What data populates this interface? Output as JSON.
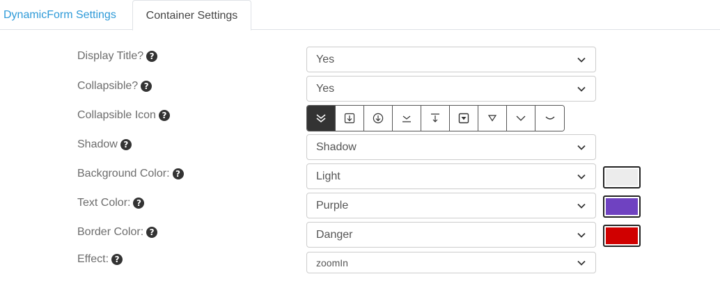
{
  "tabs": [
    {
      "label": "DynamicForm Settings"
    },
    {
      "label": "Container Settings"
    }
  ],
  "help_glyph": "?",
  "fields": {
    "display_title": {
      "label": "Display Title?",
      "value": "Yes"
    },
    "collapsible": {
      "label": "Collapsible?",
      "value": "Yes"
    },
    "collapsible_icon": {
      "label": "Collapsible Icon",
      "icons": [
        "double-chevron-down-icon",
        "box-arrow-down-icon",
        "circle-arrow-down-icon",
        "arrow-to-line-icon",
        "arrow-from-line-icon",
        "caret-square-down-icon",
        "triangle-down-icon",
        "chevron-down-icon",
        "curve-down-icon"
      ],
      "selected_index": 0
    },
    "shadow": {
      "label": "Shadow",
      "value": "Shadow"
    },
    "background_color": {
      "label": "Background Color:",
      "value": "Light",
      "swatch": "#ececec"
    },
    "text_color": {
      "label": "Text Color:",
      "value": "Purple",
      "swatch": "#6f42c1"
    },
    "border_color": {
      "label": "Border Color:",
      "value": "Danger",
      "swatch": "#d00000"
    },
    "effect": {
      "label": "Effect:",
      "value": "zoomIn"
    }
  },
  "colors": {
    "accent": "#2e9ad8",
    "active_icon_bg": "#333333"
  }
}
